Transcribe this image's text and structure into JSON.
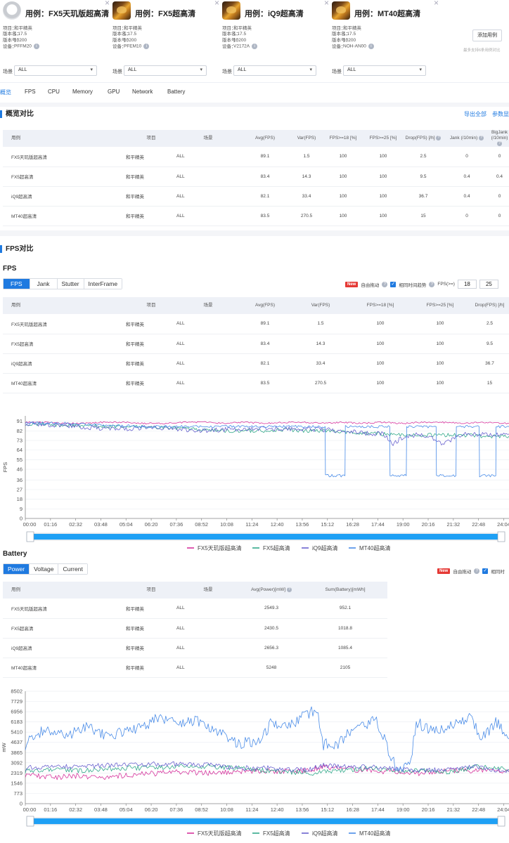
{
  "colors": {
    "accent": "#1f7ae0",
    "series": [
      "#d6339c",
      "#33a98a",
      "#6a63cf",
      "#4a8ce8"
    ]
  },
  "cards": [
    {
      "title": "用例：FX5天玑版超高清",
      "thumb": "grey",
      "project": "和平精英",
      "version_name": "1.17.5",
      "version_code": "10200",
      "device": "PFFM20",
      "scene": "ALL"
    },
    {
      "title": "用例：FX5超高清",
      "thumb": "game",
      "project": "和平精英",
      "version_name": "1.17.5",
      "version_code": "10200",
      "device": "PFEM10",
      "scene": "ALL"
    },
    {
      "title": "用例：iQ9超高清",
      "thumb": "game",
      "project": "和平精英",
      "version_name": "1.17.5",
      "version_code": "10200",
      "device": "V2172A",
      "scene": "ALL"
    },
    {
      "title": "用例：MT40超高清",
      "thumb": "game",
      "project": "和平精英",
      "version_name": "1.17.5",
      "version_code": "10200",
      "device": "NOH-AN00",
      "scene": "ALL"
    }
  ],
  "card_labels": {
    "project": "项目：",
    "version_name": "版本名：",
    "version_code": "版本号：",
    "device": "设备：",
    "scene": "场景"
  },
  "add_case": {
    "button": "添加用例",
    "hint": "最多支持6条用例对比"
  },
  "nav_tabs": [
    "概览",
    "FPS",
    "CPU",
    "Memory",
    "GPU",
    "Network",
    "Battery"
  ],
  "overview": {
    "title": "概览对比",
    "export": "导出全部",
    "params": "参数显",
    "headers": [
      "用例",
      "项目",
      "场景",
      "Avg(FPS)",
      "Var(FPS)",
      "FPS>=18 [%]",
      "FPS>=25 [%]",
      "Drop(FPS) [/h]",
      "Jank (/10min)",
      "BigJank (/10min)"
    ],
    "rows": [
      [
        "FX5天玑版超高清",
        "和平精英",
        "ALL",
        "89.1",
        "1.5",
        "100",
        "100",
        "2.5",
        "0",
        "0"
      ],
      [
        "FX5超高清",
        "和平精英",
        "ALL",
        "83.4",
        "14.3",
        "100",
        "100",
        "9.5",
        "0.4",
        "0.4"
      ],
      [
        "iQ9超高清",
        "和平精英",
        "ALL",
        "82.1",
        "33.4",
        "100",
        "100",
        "36.7",
        "0.4",
        "0"
      ],
      [
        "MT40超高清",
        "和平精英",
        "ALL",
        "83.5",
        "270.5",
        "100",
        "100",
        "15",
        "0",
        "0"
      ]
    ]
  },
  "fps_section": {
    "title": "FPS对比",
    "subtitle": "FPS",
    "tabs": [
      "FPS",
      "Jank",
      "Stutter",
      "InterFrame"
    ],
    "new_badge": "New",
    "free_drag": "自由拖动",
    "same_time": "相同时间趋势",
    "fps_ge": "FPS(>=)",
    "threshold1": "18",
    "threshold2": "25",
    "headers": [
      "用例",
      "项目",
      "场景",
      "Avg(FPS)",
      "Var(FPS)",
      "FPS>=18 [%]",
      "FPS>=25 [%]",
      "Drop(FPS) [/h]"
    ],
    "rows": [
      [
        "FX5天玑版超高清",
        "和平精英",
        "ALL",
        "89.1",
        "1.5",
        "100",
        "100",
        "2.5"
      ],
      [
        "FX5超高清",
        "和平精英",
        "ALL",
        "83.4",
        "14.3",
        "100",
        "100",
        "9.5"
      ],
      [
        "iQ9超高清",
        "和平精英",
        "ALL",
        "82.1",
        "33.4",
        "100",
        "100",
        "36.7"
      ],
      [
        "MT40超高清",
        "和平精英",
        "ALL",
        "83.5",
        "270.5",
        "100",
        "100",
        "15"
      ]
    ]
  },
  "battery_section": {
    "title": "Battery",
    "tabs": [
      "Power",
      "Voltage",
      "Current"
    ],
    "new_badge": "New",
    "free_drag": "自由拖动",
    "same_time": "相同时",
    "headers": [
      "用例",
      "项目",
      "场景",
      "Avg(Power)[mW]",
      "Sum(Battery)[mWh]"
    ],
    "rows": [
      [
        "FX5天玑版超高清",
        "和平精英",
        "ALL",
        "2549.3",
        "952.1"
      ],
      [
        "FX5超高清",
        "和平精英",
        "ALL",
        "2430.5",
        "1018.8"
      ],
      [
        "iQ9超高清",
        "和平精英",
        "ALL",
        "2656.3",
        "1085.4"
      ],
      [
        "MT40超高清",
        "和平精英",
        "ALL",
        "5248",
        "2105"
      ]
    ]
  },
  "chart_data": [
    {
      "type": "line",
      "ylabel": "FPS",
      "xlabel": "",
      "yticks": [
        0,
        9,
        18,
        27,
        36,
        46,
        55,
        64,
        73,
        82,
        91
      ],
      "ylim": [
        0,
        96
      ],
      "xticks": [
        "00:00",
        "01:16",
        "02:32",
        "03:48",
        "05:04",
        "06:20",
        "07:36",
        "08:52",
        "10:08",
        "11:24",
        "12:40",
        "13:56",
        "15:12",
        "16:28",
        "17:44",
        "19:00",
        "20:16",
        "21:32",
        "22:48",
        "24:04"
      ],
      "xlim_min": [
        0,
        1460
      ],
      "legend_position": "bottom",
      "series": [
        {
          "name": "FX5天玑版超高清",
          "points_min": [
            [
              0,
              90
            ],
            [
              60,
              90
            ],
            [
              120,
              89
            ],
            [
              180,
              89
            ],
            [
              240,
              90
            ],
            [
              300,
              90
            ],
            [
              360,
              89
            ],
            [
              420,
              89
            ],
            [
              480,
              90
            ],
            [
              540,
              90
            ],
            [
              600,
              89
            ],
            [
              660,
              90
            ],
            [
              720,
              89
            ],
            [
              780,
              90
            ],
            [
              840,
              90
            ],
            [
              900,
              89
            ],
            [
              960,
              90
            ],
            [
              1020,
              89
            ],
            [
              1080,
              90
            ],
            [
              1140,
              89
            ],
            [
              1200,
              90
            ],
            [
              1260,
              90
            ],
            [
              1320,
              89
            ],
            [
              1380,
              90
            ],
            [
              1460,
              89
            ]
          ]
        },
        {
          "name": "FX5超高清",
          "points_min": [
            [
              0,
              89
            ],
            [
              60,
              88
            ],
            [
              120,
              87
            ],
            [
              180,
              87
            ],
            [
              240,
              86
            ],
            [
              300,
              86
            ],
            [
              360,
              86
            ],
            [
              420,
              85
            ],
            [
              480,
              84
            ],
            [
              540,
              83
            ],
            [
              600,
              82
            ],
            [
              660,
              82
            ],
            [
              720,
              82
            ],
            [
              780,
              83
            ],
            [
              840,
              82
            ],
            [
              900,
              82
            ],
            [
              960,
              81
            ],
            [
              1020,
              80
            ],
            [
              1080,
              79
            ],
            [
              1140,
              78
            ],
            [
              1200,
              78
            ],
            [
              1260,
              78
            ],
            [
              1320,
              78
            ],
            [
              1380,
              77
            ],
            [
              1460,
              77
            ]
          ]
        },
        {
          "name": "iQ9超高清",
          "points_min": [
            [
              0,
              89
            ],
            [
              60,
              88
            ],
            [
              120,
              87
            ],
            [
              180,
              85
            ],
            [
              240,
              84
            ],
            [
              300,
              84
            ],
            [
              360,
              85
            ],
            [
              420,
              84
            ],
            [
              480,
              83
            ],
            [
              540,
              82
            ],
            [
              600,
              83
            ],
            [
              660,
              84
            ],
            [
              720,
              84
            ],
            [
              780,
              84
            ],
            [
              840,
              84
            ],
            [
              900,
              83
            ],
            [
              960,
              82
            ],
            [
              1020,
              80
            ],
            [
              1080,
              79
            ],
            [
              1110,
              70
            ],
            [
              1140,
              76
            ],
            [
              1200,
              79
            ],
            [
              1260,
              70
            ],
            [
              1320,
              79
            ],
            [
              1380,
              79
            ],
            [
              1460,
              79
            ]
          ]
        },
        {
          "name": "MT40超高清",
          "points_min": [
            [
              0,
              90
            ],
            [
              60,
              89
            ],
            [
              120,
              89
            ],
            [
              180,
              88
            ],
            [
              240,
              87
            ],
            [
              300,
              87
            ],
            [
              360,
              86
            ],
            [
              420,
              86
            ],
            [
              480,
              86
            ],
            [
              540,
              86
            ],
            [
              600,
              86
            ],
            [
              660,
              86
            ],
            [
              720,
              86
            ],
            [
              780,
              86
            ],
            [
              840,
              86
            ],
            [
              905,
              86
            ],
            [
              906,
              40
            ],
            [
              965,
              40
            ],
            [
              966,
              86
            ],
            [
              1100,
              86
            ],
            [
              1101,
              40
            ],
            [
              1150,
              40
            ],
            [
              1151,
              86
            ],
            [
              1240,
              86
            ],
            [
              1241,
              40
            ],
            [
              1300,
              40
            ],
            [
              1301,
              86
            ],
            [
              1370,
              86
            ],
            [
              1371,
              40
            ],
            [
              1420,
              40
            ],
            [
              1421,
              86
            ],
            [
              1460,
              86
            ]
          ]
        }
      ]
    },
    {
      "type": "line",
      "ylabel": "mW",
      "xlabel": "",
      "yticks": [
        0,
        773,
        1546,
        2319,
        3092,
        3865,
        4637,
        5410,
        6183,
        6956,
        7729,
        8502
      ],
      "ylim": [
        0,
        8502
      ],
      "xticks": [
        "00:00",
        "01:16",
        "02:32",
        "03:48",
        "05:04",
        "06:20",
        "07:36",
        "08:52",
        "10:08",
        "11:24",
        "12:40",
        "13:56",
        "15:12",
        "16:28",
        "17:44",
        "19:00",
        "20:16",
        "21:32",
        "22:48",
        "24:04"
      ],
      "xlim_min": [
        0,
        1460
      ],
      "legend_position": "bottom",
      "series": [
        {
          "name": "FX5天玑版超高清",
          "points_min": [
            [
              0,
              2200
            ],
            [
              80,
              2000
            ],
            [
              160,
              2100
            ],
            [
              240,
              2000
            ],
            [
              320,
              2200
            ],
            [
              400,
              2300
            ],
            [
              480,
              2400
            ],
            [
              560,
              2300
            ],
            [
              640,
              2400
            ],
            [
              720,
              2500
            ],
            [
              800,
              2450
            ],
            [
              860,
              2500
            ],
            [
              900,
              2800
            ],
            [
              960,
              2600
            ],
            [
              1040,
              2500
            ],
            [
              1120,
              2400
            ],
            [
              1200,
              2300
            ],
            [
              1280,
              2500
            ],
            [
              1360,
              2500
            ],
            [
              1460,
              2400
            ]
          ]
        },
        {
          "name": "FX5超高清",
          "points_min": [
            [
              0,
              2500
            ],
            [
              80,
              2600
            ],
            [
              160,
              2500
            ],
            [
              240,
              2600
            ],
            [
              320,
              2700
            ],
            [
              400,
              2700
            ],
            [
              480,
              2800
            ],
            [
              560,
              2800
            ],
            [
              640,
              2700
            ],
            [
              720,
              2500
            ],
            [
              800,
              2400
            ],
            [
              860,
              2300
            ],
            [
              900,
              2400
            ],
            [
              960,
              2500
            ],
            [
              1040,
              2700
            ],
            [
              1120,
              2500
            ],
            [
              1200,
              2500
            ],
            [
              1280,
              2400
            ],
            [
              1360,
              2800
            ],
            [
              1460,
              2600
            ]
          ]
        },
        {
          "name": "iQ9超高清",
          "points_min": [
            [
              0,
              2700
            ],
            [
              80,
              2800
            ],
            [
              160,
              2800
            ],
            [
              240,
              2900
            ],
            [
              320,
              2900
            ],
            [
              400,
              3000
            ],
            [
              480,
              3000
            ],
            [
              560,
              2900
            ],
            [
              640,
              2700
            ],
            [
              720,
              2700
            ],
            [
              800,
              2600
            ],
            [
              860,
              2600
            ],
            [
              900,
              2900
            ],
            [
              960,
              2800
            ],
            [
              1040,
              2800
            ],
            [
              1120,
              2600
            ],
            [
              1200,
              2500
            ],
            [
              1280,
              2600
            ],
            [
              1360,
              2800
            ],
            [
              1460,
              2400
            ]
          ]
        },
        {
          "name": "MT40超高清",
          "points_min": [
            [
              0,
              4500
            ],
            [
              60,
              5600
            ],
            [
              120,
              5000
            ],
            [
              180,
              5800
            ],
            [
              240,
              5200
            ],
            [
              300,
              5400
            ],
            [
              360,
              5800
            ],
            [
              400,
              6600
            ],
            [
              460,
              6000
            ],
            [
              520,
              6300
            ],
            [
              560,
              5600
            ],
            [
              600,
              5300
            ],
            [
              620,
              4600
            ],
            [
              700,
              4600
            ],
            [
              740,
              6000
            ],
            [
              800,
              5800
            ],
            [
              840,
              6800
            ],
            [
              880,
              7000
            ],
            [
              900,
              4500
            ],
            [
              940,
              4400
            ],
            [
              1000,
              6000
            ],
            [
              1060,
              6200
            ],
            [
              1080,
              5100
            ],
            [
              1120,
              2600
            ],
            [
              1160,
              2800
            ],
            [
              1180,
              6200
            ],
            [
              1240,
              5400
            ],
            [
              1300,
              6200
            ],
            [
              1340,
              6600
            ],
            [
              1380,
              4900
            ],
            [
              1420,
              6300
            ],
            [
              1460,
              4900
            ]
          ]
        }
      ]
    }
  ]
}
